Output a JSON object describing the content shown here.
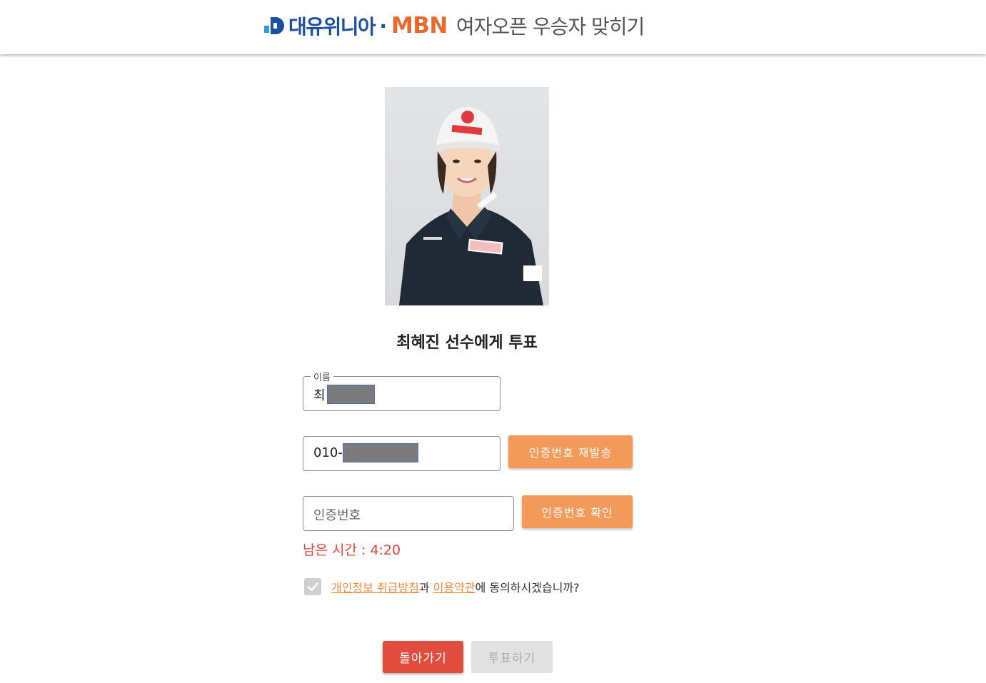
{
  "header": {
    "sponsor": "대유위니아",
    "separator": "·",
    "brand": "MBN",
    "title": "여자오픈 우승자 맞히기",
    "colors": {
      "sponsor": "#1d4fa0",
      "brand": "#e9692c"
    }
  },
  "player": {
    "photo_alt": "최혜진",
    "vote_title": "최혜진 선수에게 투표"
  },
  "form": {
    "name_legend": "이름",
    "name_value": "최",
    "phone_value": "010-",
    "resend_button": "인증번호 재발송",
    "code_placeholder": "인증번호",
    "confirm_button": "인증번호 확인",
    "timer_label": "남은 시간 : 4:20"
  },
  "agreement": {
    "checked": true,
    "privacy_link": "개인정보 취급방침",
    "conj": "과 ",
    "terms_link": "이용약관",
    "suffix": "에 동의하시겠습니까?"
  },
  "actions": {
    "back": "돌아가기",
    "vote": "투표하기"
  },
  "colors": {
    "accent_orange": "#f39a5a",
    "back_red": "#e24c3d",
    "timer_red": "#e0463b",
    "disabled_gray": "#e2e2e2"
  }
}
